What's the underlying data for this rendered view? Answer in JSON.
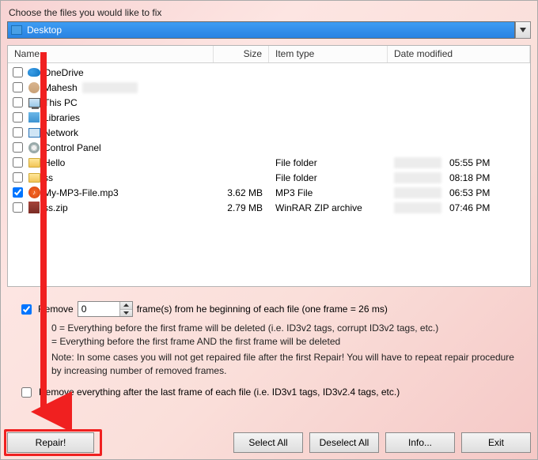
{
  "prompt": "Choose the files you would like to fix",
  "path": {
    "label": "Desktop"
  },
  "columns": {
    "name": "Name",
    "size": "Size",
    "type": "Item type",
    "date": "Date modified"
  },
  "rows": [
    {
      "checked": false,
      "icon": "onedrive",
      "name": "OneDrive",
      "size": "",
      "type": "",
      "date": "",
      "dateBlur": false,
      "nameBlur": false
    },
    {
      "checked": false,
      "icon": "user",
      "name": "Mahesh",
      "size": "",
      "type": "",
      "date": "",
      "dateBlur": false,
      "nameBlur": true
    },
    {
      "checked": false,
      "icon": "pc",
      "name": "This PC",
      "size": "",
      "type": "",
      "date": "",
      "dateBlur": false
    },
    {
      "checked": false,
      "icon": "libs",
      "name": "Libraries",
      "size": "",
      "type": "",
      "date": "",
      "dateBlur": false
    },
    {
      "checked": false,
      "icon": "net",
      "name": "Network",
      "size": "",
      "type": "",
      "date": "",
      "dateBlur": false
    },
    {
      "checked": false,
      "icon": "cpl",
      "name": "Control Panel",
      "size": "",
      "type": "",
      "date": "",
      "dateBlur": false
    },
    {
      "checked": false,
      "icon": "folder",
      "name": "Hello",
      "size": "",
      "type": "File folder",
      "date": "05:55 PM",
      "dateBlur": true
    },
    {
      "checked": false,
      "icon": "folder",
      "name": "ss",
      "size": "",
      "type": "File folder",
      "date": "08:18 PM",
      "dateBlur": true
    },
    {
      "checked": true,
      "icon": "mp3",
      "name": "My-MP3-File.mp3",
      "size": "3.62 MB",
      "type": "MP3 File",
      "date": "06:53 PM",
      "dateBlur": true
    },
    {
      "checked": false,
      "icon": "zip",
      "name": "ss.zip",
      "size": "2.79 MB",
      "type": "WinRAR ZIP archive",
      "date": "07:46 PM",
      "dateBlur": true
    }
  ],
  "remove": {
    "checked": true,
    "label_before": "Remove",
    "value": "0",
    "label_after": "frame(s) from he beginning of each file (one frame = 26 ms)"
  },
  "help": {
    "line1": "0  = Everything before the first frame will be deleted (i.e. ID3v2 tags, corrupt ID3v2 tags, etc.)",
    "line2": "    = Everything before the first frame AND the first frame will be deleted",
    "line3": "Note: In some cases you will not get repaired file after the first Repair! You will have to repeat repair procedure by increasing number of removed frames."
  },
  "remove_after": {
    "checked": false,
    "label": "Remove everything after the last frame of each file (i.e. ID3v1 tags, ID3v2.4 tags, etc.)"
  },
  "buttons": {
    "repair": "Repair!",
    "select_all": "Select All",
    "deselect_all": "Deselect All",
    "info": "Info...",
    "exit": "Exit"
  }
}
